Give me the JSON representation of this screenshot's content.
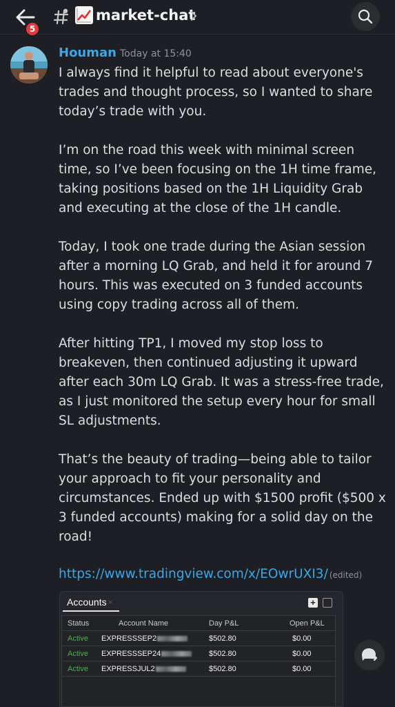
{
  "header": {
    "back_icon": "arrow-left-icon",
    "unread_count": "5",
    "channel_icon": "hash-icon",
    "channel_emoji": "chart-increasing-emoji",
    "channel_name": "market-chat",
    "chevron_icon": "chevron-right-icon",
    "search_icon": "search-icon"
  },
  "message": {
    "author": "Houman",
    "author_color": "#3ba7e8",
    "timestamp": "Today at 15:40",
    "paragraphs": [
      "I always find it helpful to read about everyone's trades and thought process, so I wanted to share today’s trade with you.",
      "I’m on the road this week with minimal screen time, so I’ve been focusing on the 1H time frame, taking positions based on the 1H Liquidity Grab and executing at the close of the 1H candle.",
      "Today, I took one trade during the Asian session after a morning LQ Grab, and held it for around 7 hours. This was executed on 3 funded accounts using copy trading across all of them.",
      "After hitting TP1, I moved my stop loss to breakeven, then continued adjusting it upward after each 30m LQ Grab. It was a stress-free trade, as I just monitored the setup every hour for small SL adjustments.",
      "That’s the beauty of trading—being able to tailor your approach to fit your personality and circumstances. Ended up with $1500 profit ($500 x 3 funded accounts)  making for a solid day on the road!"
    ],
    "link": "https://www.tradingview.com/x/EOwrUXI3/",
    "edited_label": "(edited)"
  },
  "embed": {
    "tab_label": "Accounts",
    "tab_close": "×",
    "add_button": "+",
    "columns": [
      "Status",
      "Account Name",
      "Day P&L",
      "Open P&L"
    ],
    "rows": [
      {
        "status": "Active",
        "name": "EXPRESSSEP2",
        "day_pnl": "$502.80",
        "open_pnl": "$0.00"
      },
      {
        "status": "Active",
        "name": "EXPRESSSEP24",
        "day_pnl": "$502.80",
        "open_pnl": "$0.00"
      },
      {
        "status": "Active",
        "name": "EXPRESSJUL2",
        "day_pnl": "$502.80",
        "open_pnl": "$0.00"
      }
    ],
    "status_color": "#4caf50"
  },
  "fab": {
    "icon": "reply-thread-icon"
  }
}
